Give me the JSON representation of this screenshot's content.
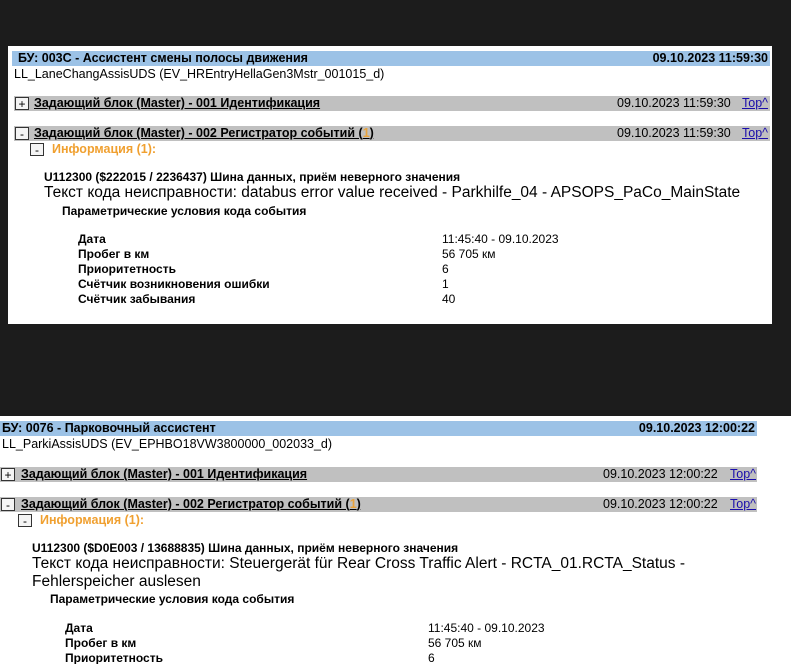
{
  "ecus": [
    {
      "title": "БУ: 003C - Ассистент смены полосы движения",
      "date": "09.10.2023 11:59:30",
      "subtitle": "LL_LaneChangAssisUDS (EV_HREntryHellaGen3Mstr_001015_d)",
      "sections": [
        {
          "toggle": "+",
          "title": "Задающий блок (Master) - 001 Идентификация",
          "count": "",
          "date": "09.10.2023 11:59:30",
          "top_link": "Top^"
        },
        {
          "toggle": "-",
          "title": "Задающий блок (Master) - 002 Регистратор событий (",
          "count": "1",
          "title_end": ")",
          "date": "09.10.2023 11:59:30",
          "top_link": "Top^"
        }
      ],
      "info": {
        "toggle": "-",
        "title": "Информация (1):",
        "fault_title": "U112300 ($222015 / 2236437) Шина данных, приём неверного значения",
        "fault_text": "Текст кода неисправности: databus error value received - Parkhilfe_04 - APSOPS_PaCo_MainState",
        "param_heading": "Параметрические условия кода события",
        "params": [
          {
            "label": "Дата",
            "value": "11:45:40 - 09.10.2023"
          },
          {
            "label": "Пробег в км",
            "value": "56 705 км"
          },
          {
            "label": "Приоритетность",
            "value": "6"
          },
          {
            "label": "Счётчик возникновения ошибки",
            "value": "1"
          },
          {
            "label": "Счётчик забывания",
            "value": "40"
          }
        ]
      }
    },
    {
      "title": "БУ: 0076 - Парковочный ассистент",
      "date": "09.10.2023 12:00:22",
      "subtitle": "LL_ParkiAssisUDS (EV_EPHBO18VW3800000_002033_d)",
      "sections": [
        {
          "toggle": "+",
          "title": "Задающий блок (Master) - 001 Идентификация",
          "count": "",
          "date": "09.10.2023 12:00:22",
          "top_link": "Top^"
        },
        {
          "toggle": "-",
          "title": "Задающий блок (Master) - 002 Регистратор событий (",
          "count": "1",
          "title_end": ")",
          "date": "09.10.2023 12:00:22",
          "top_link": "Top^"
        }
      ],
      "info": {
        "toggle": "-",
        "title": "Информация (1):",
        "fault_title": "U112300 ($D0E003 / 13688835) Шина данных, приём неверного значения",
        "fault_text": "Текст кода неисправности: Steuergerät für Rear Cross Traffic Alert - RCTA_01.RCTA_Status - Fehlerspeicher auslesen",
        "param_heading": "Параметрические условия кода события",
        "params": [
          {
            "label": "Дата",
            "value": "11:45:40 - 09.10.2023"
          },
          {
            "label": "Пробег в км",
            "value": "56 705 км"
          },
          {
            "label": "Приоритетность",
            "value": "6"
          }
        ]
      }
    }
  ]
}
